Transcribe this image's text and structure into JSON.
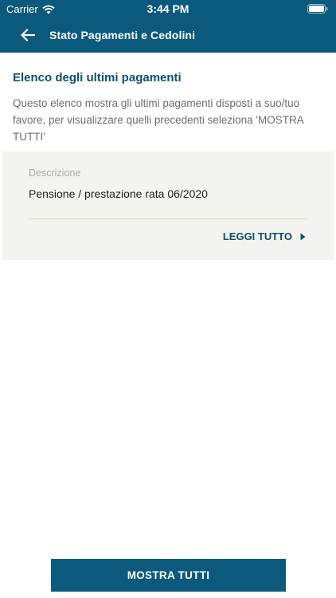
{
  "status_bar": {
    "carrier": "Carrier",
    "time": "3:44 PM"
  },
  "navbar": {
    "title": "Stato Pagamenti e Cedolini",
    "back_icon": "arrow-left-icon"
  },
  "content": {
    "section_title": "Elenco degli ultimi pagamenti",
    "intro_text": "Questo elenco mostra gli ultimi pagamenti disposti a suo/tuo favore, per visualizzare quelli precedenti seleziona 'MOSTRA TUTTI'"
  },
  "payment_card": {
    "description_label": "Descrizione",
    "description_value": "Pensione / prestazione rata 06/2020",
    "read_more_label": "LEGGI TUTTO"
  },
  "footer": {
    "show_all_label": "MOSTRA TUTTI"
  },
  "colors": {
    "primary": "#0b5a7e",
    "title_text": "#0b4f73",
    "card_background": "#f3f3ef"
  }
}
